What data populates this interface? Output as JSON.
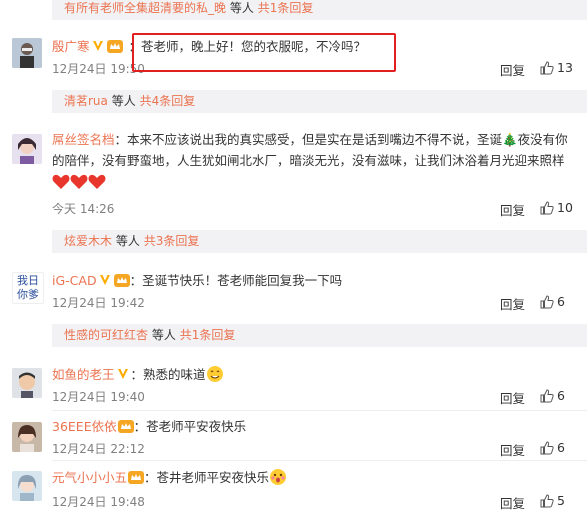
{
  "thread0": {
    "prefix": "有所有老师全集超清要的私_晚",
    "suffix": "等人",
    "count": "共1条回复"
  },
  "c1": {
    "user": "殷广寒",
    "text": "苍老师，晚上好！您的衣服呢，不冷吗？",
    "time": "12月24日 19:50",
    "reply": "回复",
    "likes": "13"
  },
  "thread1": {
    "user": "清茗rua",
    "suffix": "等人",
    "count": "共4条回复"
  },
  "c2": {
    "user": "屌丝签名档",
    "text": "本来不应该说出我的真实感受，但是实在是话到嘴边不得不说，圣诞🎄夜没有你的陪伴，没有野蛮地，人生犹如闸北水厂，暗淡无光，没有滋味，让我们沐浴着月光迎来照样",
    "time": "今天 14:26",
    "reply": "回复",
    "likes": "10"
  },
  "thread2": {
    "user": "炫爱木木",
    "suffix": "等人",
    "count": "共3条回复"
  },
  "c3": {
    "user": "iG-CAD",
    "text": "圣诞节快乐！苍老师能回复我一下吗",
    "time": "12月24日 19:42",
    "reply": "回复",
    "likes": "6"
  },
  "thread3": {
    "user": "性感的可红红杏",
    "suffix": "等人",
    "count": "共1条回复"
  },
  "c4": {
    "user": "如鱼的老王",
    "text": "熟悉的味道",
    "time": "12月24日 19:40",
    "reply": "回复",
    "likes": "6"
  },
  "c5": {
    "user": "36EEE依依",
    "text": "苍老师平安夜快乐",
    "time": "12月24日 22:12",
    "reply": "回复",
    "likes": "6"
  },
  "c6": {
    "user": "元气小小小五",
    "text": "苍井老师平安夜快乐",
    "time": "12月24日 19:48",
    "reply": "回复",
    "likes": "5"
  },
  "colors": {
    "accent": "#eb7350",
    "verified": "#ffab00",
    "highlight": "#e02020"
  },
  "avatar_c3_text": "我日你爹"
}
